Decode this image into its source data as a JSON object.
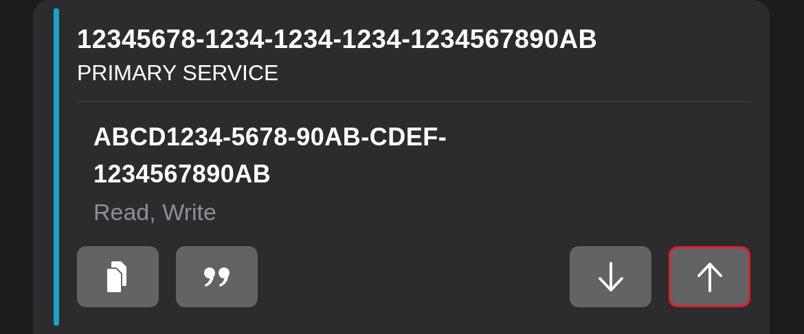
{
  "service": {
    "uuid": "12345678-1234-1234-1234-1234567890AB",
    "type": "PRIMARY SERVICE"
  },
  "characteristic": {
    "uuid": "ABCD1234-5678-90AB-CDEF-1234567890AB",
    "properties": "Read, Write"
  },
  "buttons": [
    {
      "kind": "copy",
      "selected": false
    },
    {
      "kind": "quote",
      "selected": false
    },
    {
      "kind": "down",
      "selected": false
    },
    {
      "kind": "up",
      "selected": true
    }
  ]
}
